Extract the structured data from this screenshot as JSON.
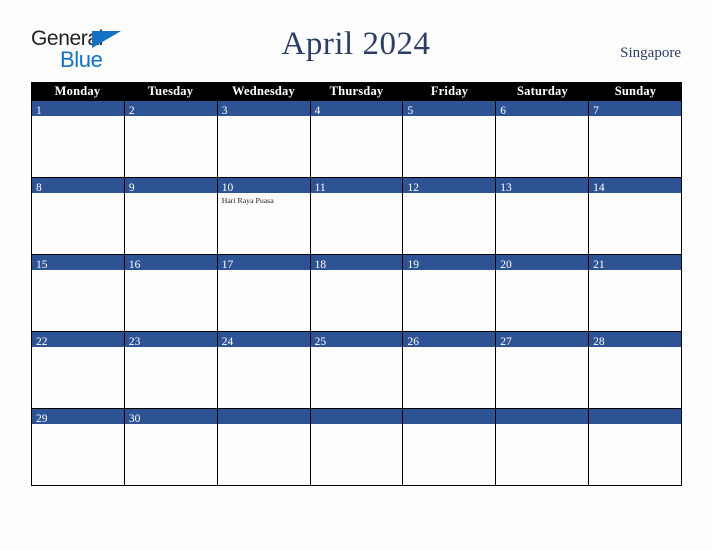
{
  "logo": {
    "word_dark": "General",
    "word_blue": "Blue",
    "triangle_color": "#1372c4",
    "dark_color": "#231f20"
  },
  "header": {
    "title": "April 2024",
    "region": "Singapore",
    "title_color": "#2b3f66"
  },
  "calendar": {
    "weekday_headers": [
      "Monday",
      "Tuesday",
      "Wednesday",
      "Thursday",
      "Friday",
      "Saturday",
      "Sunday"
    ],
    "header_bg": "#000000",
    "header_text_color": "#ffffff",
    "day_bar_color": "#2e5395",
    "day_text_color": "#ffffff",
    "cell_bg": "#fdfdfd",
    "weeks": [
      [
        {
          "day": "1",
          "events": []
        },
        {
          "day": "2",
          "events": []
        },
        {
          "day": "3",
          "events": []
        },
        {
          "day": "4",
          "events": []
        },
        {
          "day": "5",
          "events": []
        },
        {
          "day": "6",
          "events": []
        },
        {
          "day": "7",
          "events": []
        }
      ],
      [
        {
          "day": "8",
          "events": []
        },
        {
          "day": "9",
          "events": []
        },
        {
          "day": "10",
          "events": [
            "Hari Raya Puasa"
          ]
        },
        {
          "day": "11",
          "events": []
        },
        {
          "day": "12",
          "events": []
        },
        {
          "day": "13",
          "events": []
        },
        {
          "day": "14",
          "events": []
        }
      ],
      [
        {
          "day": "15",
          "events": []
        },
        {
          "day": "16",
          "events": []
        },
        {
          "day": "17",
          "events": []
        },
        {
          "day": "18",
          "events": []
        },
        {
          "day": "19",
          "events": []
        },
        {
          "day": "20",
          "events": []
        },
        {
          "day": "21",
          "events": []
        }
      ],
      [
        {
          "day": "22",
          "events": []
        },
        {
          "day": "23",
          "events": []
        },
        {
          "day": "24",
          "events": []
        },
        {
          "day": "25",
          "events": []
        },
        {
          "day": "26",
          "events": []
        },
        {
          "day": "27",
          "events": []
        },
        {
          "day": "28",
          "events": []
        }
      ],
      [
        {
          "day": "29",
          "events": []
        },
        {
          "day": "30",
          "events": []
        },
        {
          "day": "",
          "events": []
        },
        {
          "day": "",
          "events": []
        },
        {
          "day": "",
          "events": []
        },
        {
          "day": "",
          "events": []
        },
        {
          "day": "",
          "events": []
        }
      ]
    ]
  }
}
